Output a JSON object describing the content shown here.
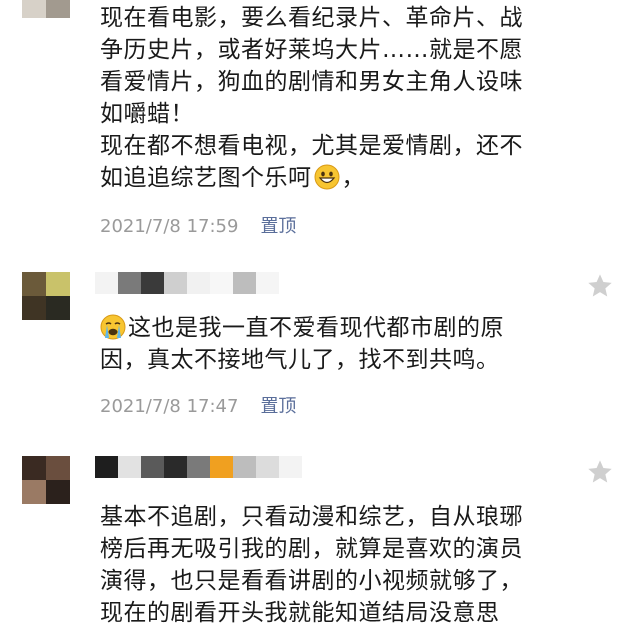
{
  "comments": [
    {
      "lines": [
        "现在看电影，要么看纪录片、革命片、战",
        "争历史片，或者好莱坞大片……就是不愿",
        "看爱情片，狗血的剧情和男女主角人设味",
        "如嚼蜡！",
        "现在都不想看电视，尤其是爱情剧，还不",
        "如追追综艺图个乐呵"
      ],
      "tail": "，",
      "emoji": "grinning-face",
      "time": "2021/7/8 17:59",
      "pin": "置顶"
    },
    {
      "emoji": "loudly-crying-face",
      "lines": [
        "这也是我一直不爱看现代都市剧的原",
        "因，真太不接地气儿了，找不到共鸣。"
      ],
      "time": "2021/7/8 17:47",
      "pin": "置顶"
    },
    {
      "lines": [
        "基本不追剧，只看动漫和综艺，自从琅琊",
        "榜后再无吸引我的剧，就算是喜欢的演员",
        "演得，也只是看看讲剧的小视频就够了，",
        "现在的剧看开头我就能知道结局没意思"
      ]
    }
  ],
  "colors": {
    "text": "#1a1a1a",
    "meta": "#9a9a9a",
    "pin": "#5a6e9a",
    "star": "#cfcfcf"
  },
  "icons": {
    "favorite": "star-icon"
  }
}
